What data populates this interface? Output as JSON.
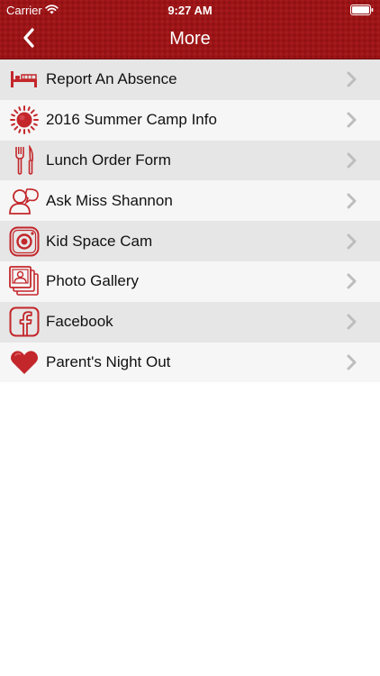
{
  "status_bar": {
    "carrier": "Carrier",
    "time": "9:27 AM"
  },
  "nav": {
    "title": "More"
  },
  "colors": {
    "brand_red": "#9e1416",
    "icon_red": "#c3272b",
    "row_alt": "#e6e6e6",
    "row_base": "#f6f6f6",
    "chevron": "#bdbdbd"
  },
  "menu": {
    "items": [
      {
        "label": "Report An Absence",
        "icon": "bed-icon"
      },
      {
        "label": "2016 Summer Camp Info",
        "icon": "sun-icon"
      },
      {
        "label": "Lunch Order Form",
        "icon": "fork-knife-icon"
      },
      {
        "label": "Ask Miss Shannon",
        "icon": "person-chat-icon"
      },
      {
        "label": "Kid Space Cam",
        "icon": "camera-icon"
      },
      {
        "label": "Photo Gallery",
        "icon": "photos-icon"
      },
      {
        "label": "Facebook",
        "icon": "facebook-icon"
      },
      {
        "label": "Parent's Night Out",
        "icon": "heart-icon"
      }
    ]
  }
}
